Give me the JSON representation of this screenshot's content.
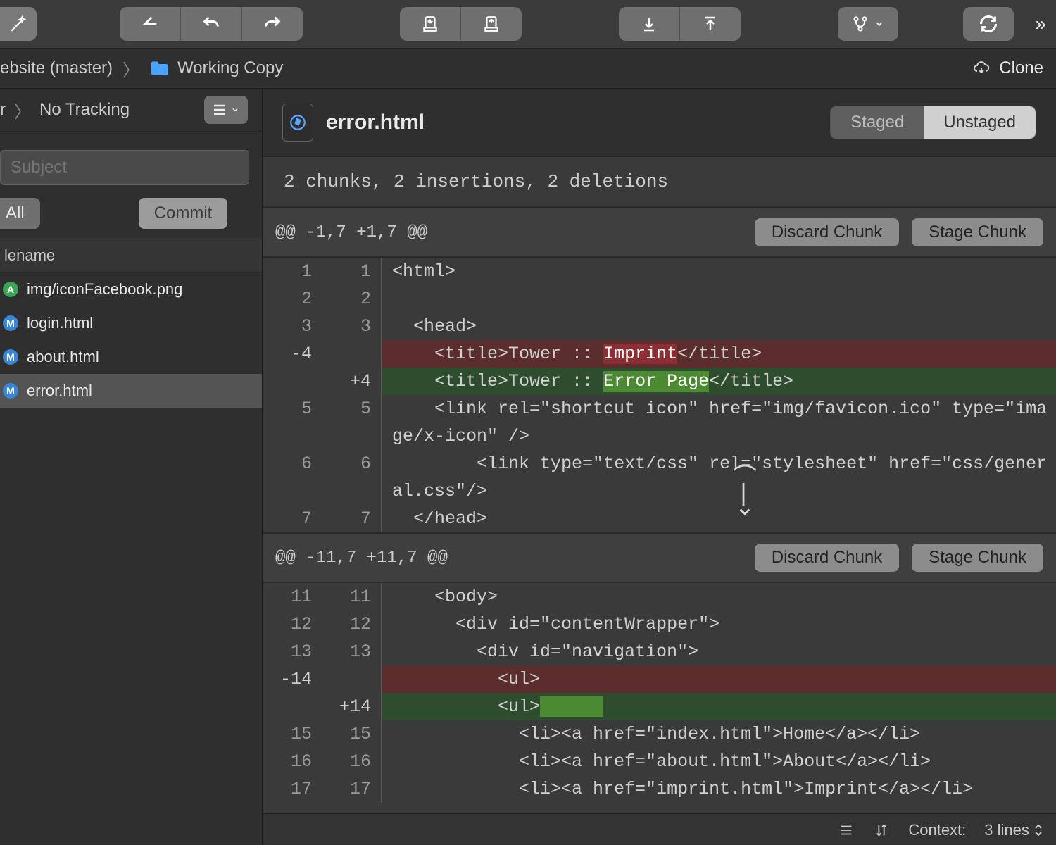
{
  "breadcrumb": {
    "repo": "ebsite (master)",
    "location": "Working Copy",
    "clone": "Clone"
  },
  "sidebar": {
    "head_left": "r",
    "tracking": "No Tracking",
    "subject_placeholder": "Subject",
    "stage_all": "All",
    "commit": "Commit",
    "col_header": "lename",
    "files": [
      {
        "status": "A",
        "name": "img/iconFacebook.png"
      },
      {
        "status": "M",
        "name": "login.html"
      },
      {
        "status": "M",
        "name": "about.html"
      },
      {
        "status": "M",
        "name": "error.html",
        "selected": true
      }
    ]
  },
  "file": {
    "name": "error.html",
    "staged": "Staged",
    "unstaged": "Unstaged",
    "summary": "2 chunks, 2 insertions, 2 deletions"
  },
  "chunks": [
    {
      "header": "@@ -1,7 +1,7 @@",
      "discard": "Discard Chunk",
      "stage": "Stage Chunk",
      "lines": [
        {
          "ol": "1",
          "nl": "1",
          "kind": "ctx",
          "text": "<html>"
        },
        {
          "ol": "2",
          "nl": "2",
          "kind": "ctx",
          "text": ""
        },
        {
          "ol": "3",
          "nl": "3",
          "kind": "ctx",
          "text": "  <head>"
        },
        {
          "ol": "-4",
          "nl": "",
          "kind": "del",
          "pre": "    <title>Tower :: ",
          "hl": "Imprint",
          "post": "</title>"
        },
        {
          "ol": "",
          "nl": "+4",
          "kind": "add",
          "pre": "    <title>Tower :: ",
          "hl": "Error Page",
          "post": "</title>"
        },
        {
          "ol": "5",
          "nl": "5",
          "kind": "ctx",
          "text": "    <link rel=\"shortcut icon\" href=\"img/favicon.ico\" type=\"image/x-icon\" />"
        },
        {
          "ol": "6",
          "nl": "6",
          "kind": "ctx",
          "text": "        <link type=\"text/css\" rel=\"stylesheet\" href=\"css/general.css\"/>"
        },
        {
          "ol": "7",
          "nl": "7",
          "kind": "ctx",
          "text": "  </head>"
        }
      ]
    },
    {
      "header": "@@ -11,7 +11,7 @@",
      "discard": "Discard Chunk",
      "stage": "Stage Chunk",
      "lines": [
        {
          "ol": "11",
          "nl": "11",
          "kind": "ctx",
          "text": "    <body>"
        },
        {
          "ol": "12",
          "nl": "12",
          "kind": "ctx",
          "text": "      <div id=\"contentWrapper\">"
        },
        {
          "ol": "13",
          "nl": "13",
          "kind": "ctx",
          "text": "        <div id=\"navigation\">"
        },
        {
          "ol": "-14",
          "nl": "",
          "kind": "del",
          "pre": "          <ul>",
          "hl": "",
          "post": ""
        },
        {
          "ol": "",
          "nl": "+14",
          "kind": "add",
          "pre": "          <ul>",
          "hl": "      ",
          "post": ""
        },
        {
          "ol": "15",
          "nl": "15",
          "kind": "ctx",
          "text": "            <li><a href=\"index.html\">Home</a></li>"
        },
        {
          "ol": "16",
          "nl": "16",
          "kind": "ctx",
          "text": "            <li><a href=\"about.html\">About</a></li>"
        },
        {
          "ol": "17",
          "nl": "17",
          "kind": "ctx",
          "text": "            <li><a href=\"imprint.html\">Imprint</a></li>"
        }
      ]
    }
  ],
  "footer": {
    "context_label": "Context:",
    "context_value": "3 lines"
  }
}
